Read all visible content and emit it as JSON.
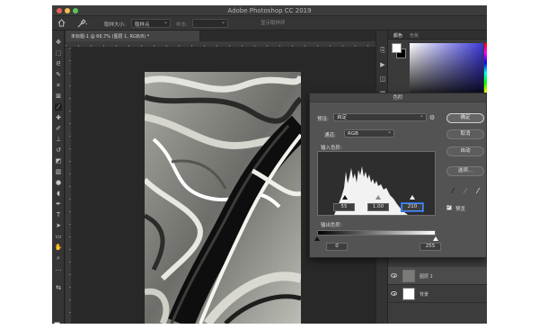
{
  "window": {
    "title": "Adobe Photoshop CC 2019"
  },
  "options_bar": {
    "sample_size_label": "取样大小:",
    "sample_size_value": "取样点",
    "sample_label": "样本:",
    "show_ring_label": "显示取样环"
  },
  "document": {
    "tab_label": "未标题-1 @ 66.7% (图层 1, RGB/8) *"
  },
  "color_panel": {
    "tabs": [
      "颜色",
      "色板"
    ],
    "foreground": "#ffffff",
    "background": "#000000"
  },
  "layers_panel": {
    "layers": [
      {
        "name": "图层 1",
        "visible": true,
        "selected": true
      },
      {
        "name": "背景",
        "visible": true,
        "selected": false
      }
    ]
  },
  "curves_dialog": {
    "title": "色阶",
    "preset_label": "预设:",
    "preset_value": "自定",
    "channel_label": "通道:",
    "channel_value": "RGB",
    "input_levels_label": "输入色阶:",
    "output_levels_label": "输出色阶:",
    "input_black": "55",
    "input_gray": "1.00",
    "input_white": "210",
    "output_black": "0",
    "output_white": "255",
    "ok_label": "确定",
    "cancel_label": "取消",
    "auto_label": "自动",
    "options_label": "选项...",
    "preview_label": "预览",
    "preview_checked": true
  }
}
